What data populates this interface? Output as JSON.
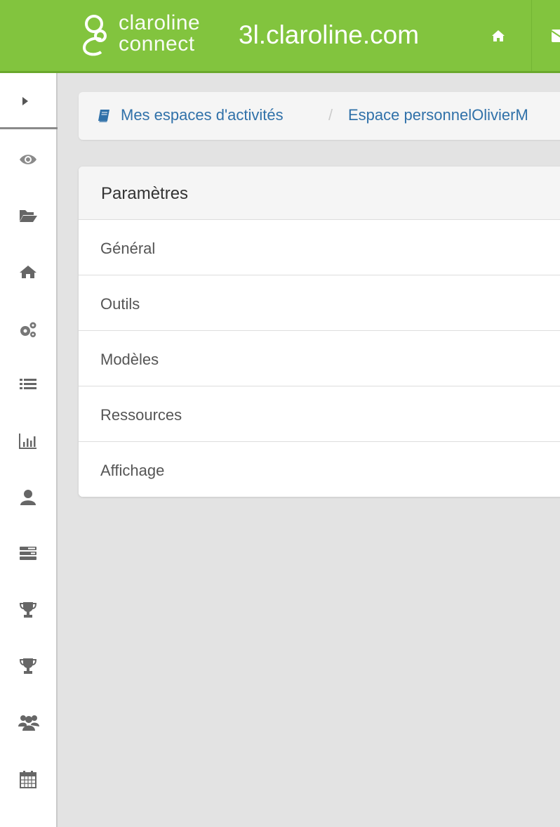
{
  "header": {
    "logo_line1": "claroline",
    "logo_line2": "connect",
    "site_title": "3l.claroline.com",
    "home_icon": "home-icon",
    "envelope_icon": "envelope-icon",
    "brand_color": "#82c43e"
  },
  "sidebar": {
    "toggle_icon": "caret-right-icon",
    "items": [
      {
        "icon": "eye-icon"
      },
      {
        "icon": "folder-open-icon"
      },
      {
        "icon": "home-icon"
      },
      {
        "icon": "cogs-icon"
      },
      {
        "icon": "list-icon"
      },
      {
        "icon": "bar-chart-icon"
      },
      {
        "icon": "user-icon"
      },
      {
        "icon": "tasks-icon"
      },
      {
        "icon": "trophy-icon"
      },
      {
        "icon": "trophy-icon"
      },
      {
        "icon": "users-icon"
      },
      {
        "icon": "calendar-icon"
      }
    ]
  },
  "breadcrumb": {
    "icon": "book-icon",
    "link1": "Mes espaces d'activités",
    "separator": "/",
    "link2": "Espace personnelOlivierM",
    "link_color": "#3071a9"
  },
  "settings_panel": {
    "title": "Paramètres",
    "items": [
      "Général",
      "Outils",
      "Modèles",
      "Ressources",
      "Affichage"
    ]
  }
}
